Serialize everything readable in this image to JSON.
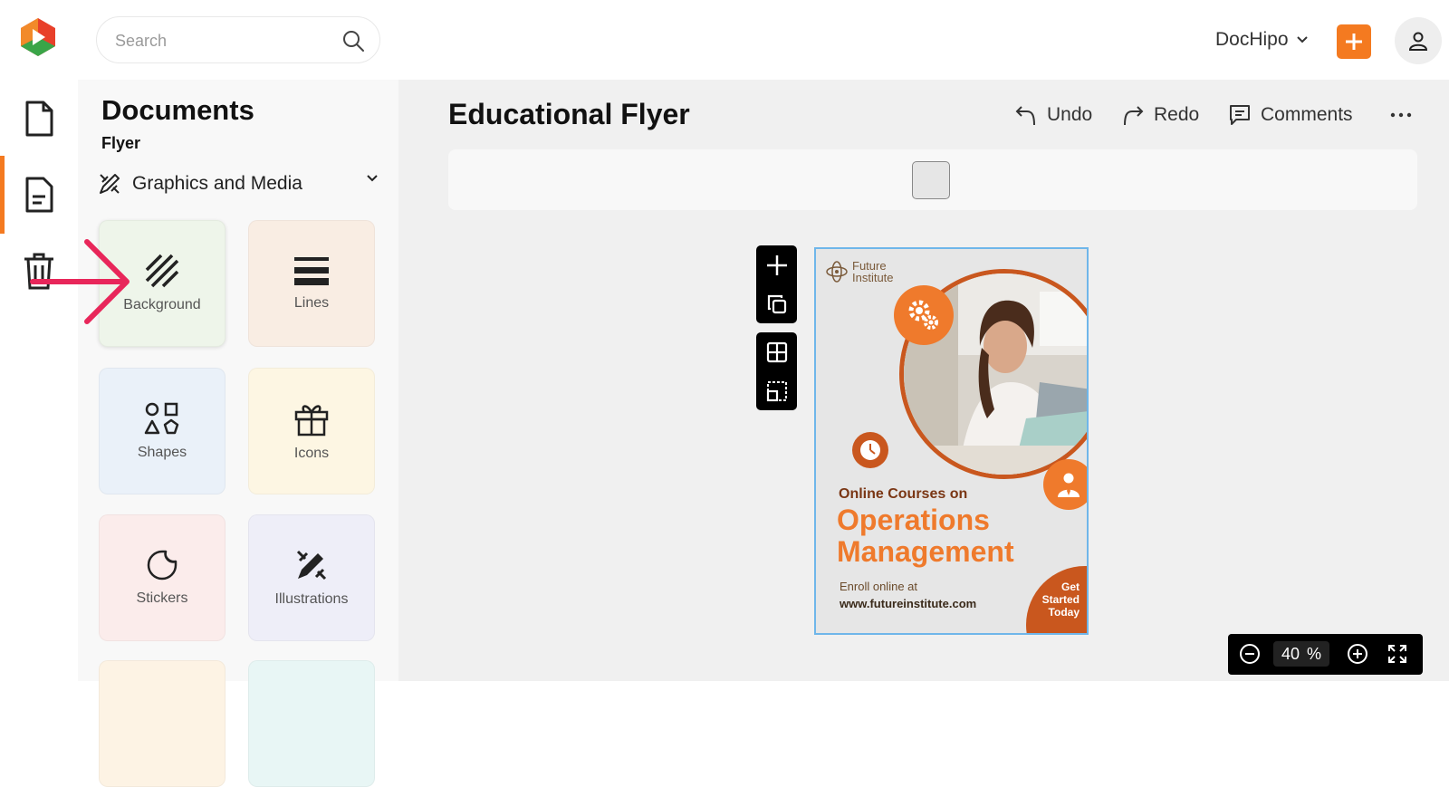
{
  "header": {
    "search": {
      "placeholder": "Search",
      "value": ""
    },
    "brand_menu": {
      "label": "DocHipo"
    },
    "add_button": {
      "label": "+"
    }
  },
  "rail": {
    "items": [
      {
        "name": "documents",
        "icon": "file-icon",
        "active": false
      },
      {
        "name": "templates",
        "icon": "document-lines-icon",
        "active": true
      },
      {
        "name": "trash",
        "icon": "trash-icon",
        "active": false
      }
    ]
  },
  "panel": {
    "title": "Documents",
    "subtitle": "Flyer",
    "category": {
      "label": "Graphics and Media",
      "icon": "pen-ruler-icon"
    },
    "tiles": [
      {
        "label": "Background",
        "icon": "hatch-pattern-icon",
        "color": "#eef5ea"
      },
      {
        "label": "Lines",
        "icon": "lines-icon",
        "color": "#f9ede3"
      },
      {
        "label": "Shapes",
        "icon": "shapes-icon",
        "color": "#eaf1f9"
      },
      {
        "label": "Icons",
        "icon": "gift-icon",
        "color": "#fdf6e3"
      },
      {
        "label": "Stickers",
        "icon": "sticker-icon",
        "color": "#fbeceb"
      },
      {
        "label": "Illustrations",
        "icon": "pen-brush-icon",
        "color": "#eeeef8"
      }
    ]
  },
  "editor": {
    "doc_title": "Educational Flyer",
    "toolbar": {
      "undo": "Undo",
      "redo": "Redo",
      "comments": "Comments"
    },
    "zoom": {
      "value": "40",
      "unit": "%"
    }
  },
  "flyer": {
    "logo_line1": "Future",
    "logo_line2": "Institute",
    "kicker": "Online Courses on",
    "headline_line1": "Operations",
    "headline_line2": "Management",
    "enroll": "Enroll online at",
    "url": "www.futureinstitute.com",
    "cta_line1": "Get",
    "cta_line2": "Started",
    "cta_line3": "Today"
  },
  "colors": {
    "accent": "#f47a20",
    "flyer_orange": "#ef7a2c",
    "flyer_rust": "#c9571e",
    "annotation": "#e8265a"
  }
}
